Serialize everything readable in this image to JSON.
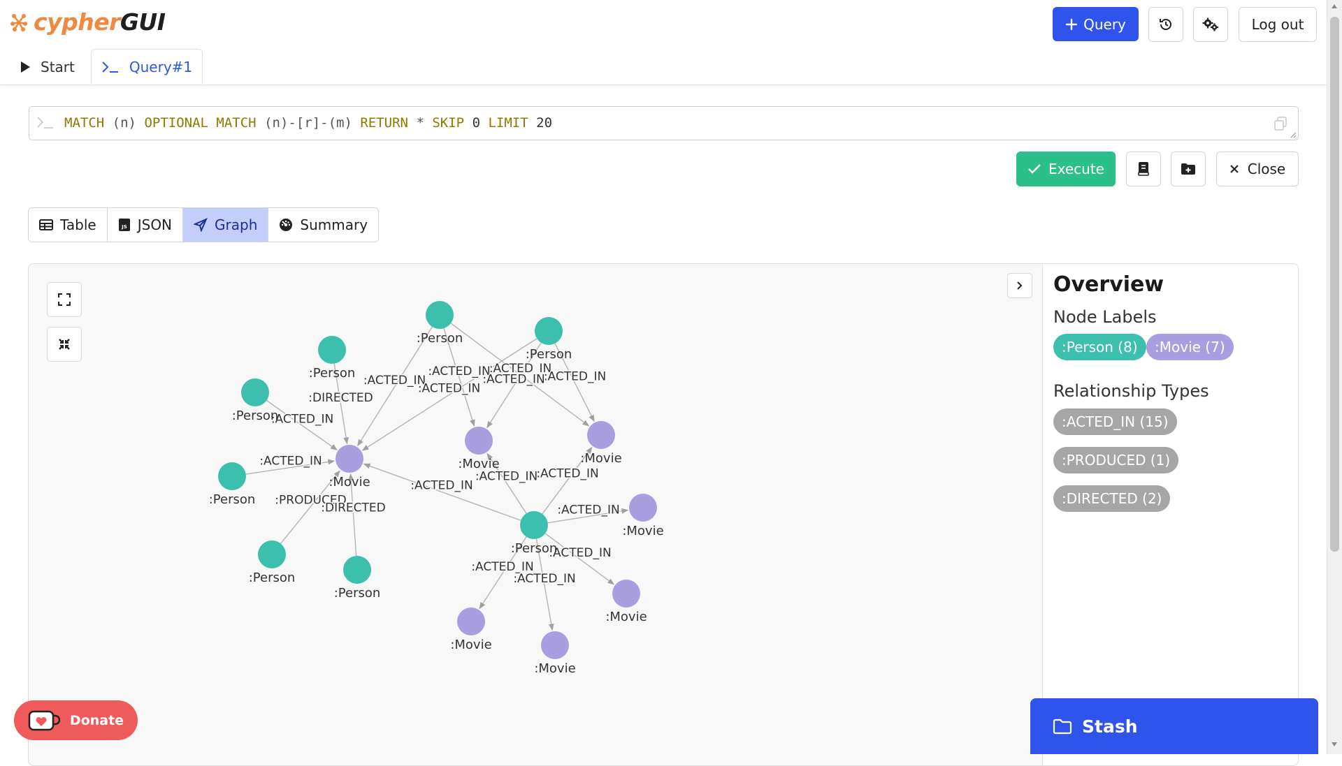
{
  "app": {
    "logo_part1": "cypher",
    "logo_part2": "GUI"
  },
  "header": {
    "query_button": "Query",
    "logout_button": "Log out",
    "tabs": [
      {
        "label": "Start",
        "icon": "play-icon"
      },
      {
        "label": "Query#1",
        "icon": "terminal-icon"
      }
    ]
  },
  "editor": {
    "query": "MATCH (n) OPTIONAL MATCH (n)-[r]-(m) RETURN * SKIP 0 LIMIT 20",
    "execute_button": "Execute",
    "close_button": "Close"
  },
  "views": [
    {
      "label": "Table",
      "icon": "table-icon",
      "active": false
    },
    {
      "label": "JSON",
      "icon": "json-icon",
      "active": false
    },
    {
      "label": "Graph",
      "icon": "graph-icon",
      "active": true
    },
    {
      "label": "Summary",
      "icon": "summary-icon",
      "active": false
    }
  ],
  "overview": {
    "title": "Overview",
    "node_labels_heading": "Node Labels",
    "node_labels": [
      {
        "label": ":Person (8)",
        "color": "#3dbfad"
      },
      {
        "label": ":Movie (7)",
        "color": "#a99ee0"
      }
    ],
    "relationship_types_heading": "Relationship Types",
    "relationship_types": [
      {
        "label": ":ACTED_IN (15)",
        "color": "#a6a6a6"
      },
      {
        "label": ":PRODUCED (1)",
        "color": "#a6a6a6"
      },
      {
        "label": ":DIRECTED (2)",
        "color": "#a6a6a6"
      }
    ]
  },
  "graph": {
    "person_color": "#3dbfad",
    "movie_color": "#a99ee0",
    "edge_color": "#b3b3b3",
    "nodes": [
      {
        "id": "P1",
        "label": ":Person",
        "kind": "person"
      },
      {
        "id": "P2",
        "label": ":Person",
        "kind": "person"
      },
      {
        "id": "P3",
        "label": ":Person",
        "kind": "person"
      },
      {
        "id": "P4",
        "label": ":Person",
        "kind": "person"
      },
      {
        "id": "P5",
        "label": ":Person",
        "kind": "person"
      },
      {
        "id": "P6",
        "label": ":Person",
        "kind": "person"
      },
      {
        "id": "P7",
        "label": ":Person",
        "kind": "person"
      },
      {
        "id": "P8",
        "label": ":Person",
        "kind": "person"
      },
      {
        "id": "M1",
        "label": ":Movie",
        "kind": "movie"
      },
      {
        "id": "M2",
        "label": ":Movie",
        "kind": "movie"
      },
      {
        "id": "M3",
        "label": ":Movie",
        "kind": "movie"
      },
      {
        "id": "M4",
        "label": ":Movie",
        "kind": "movie"
      },
      {
        "id": "M5",
        "label": ":Movie",
        "kind": "movie"
      },
      {
        "id": "M6",
        "label": ":Movie",
        "kind": "movie"
      },
      {
        "id": "M7",
        "label": ":Movie",
        "kind": "movie"
      }
    ],
    "edges": [
      {
        "from": "P1",
        "to": "M1",
        "label": ":ACTED_IN"
      },
      {
        "from": "P1",
        "to": "M2",
        "label": ":ACTED_IN"
      },
      {
        "from": "P1",
        "to": "M3",
        "label": ":ACTED_IN"
      },
      {
        "from": "P2",
        "to": "M1",
        "label": ":ACTED_IN"
      },
      {
        "from": "P2",
        "to": "M2",
        "label": ":ACTED_IN"
      },
      {
        "from": "P2",
        "to": "M3",
        "label": ":ACTED_IN"
      },
      {
        "from": "P3",
        "to": "M1",
        "label": ":DIRECTED"
      },
      {
        "from": "P4",
        "to": "M1",
        "label": ":ACTED_IN"
      },
      {
        "from": "P5",
        "to": "M1",
        "label": ":ACTED_IN"
      },
      {
        "from": "P6",
        "to": "M1",
        "label": ":PRODUCED"
      },
      {
        "from": "P7",
        "to": "M1",
        "label": ":DIRECTED"
      },
      {
        "from": "P8",
        "to": "M1",
        "label": ":ACTED_IN"
      },
      {
        "from": "P8",
        "to": "M2",
        "label": ":ACTED_IN"
      },
      {
        "from": "P8",
        "to": "M3",
        "label": ":ACTED_IN"
      },
      {
        "from": "P8",
        "to": "M4",
        "label": ":ACTED_IN"
      },
      {
        "from": "P8",
        "to": "M5",
        "label": ":ACTED_IN"
      },
      {
        "from": "P8",
        "to": "M6",
        "label": ":ACTED_IN"
      },
      {
        "from": "P8",
        "to": "M7",
        "label": ":ACTED_IN"
      }
    ]
  },
  "donate": {
    "label": "Donate"
  },
  "stash": {
    "label": "Stash"
  }
}
